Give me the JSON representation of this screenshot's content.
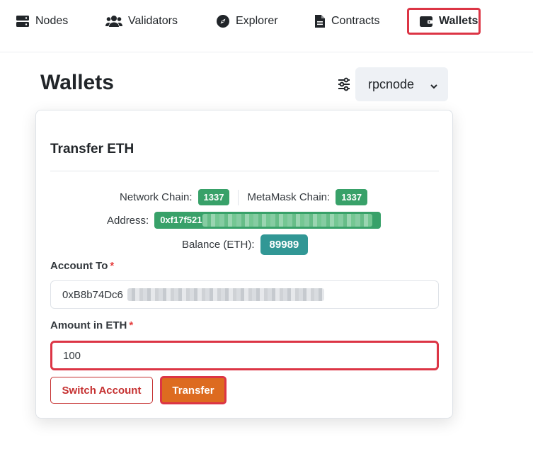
{
  "nav": {
    "nodes": "Nodes",
    "validators": "Validators",
    "explorer": "Explorer",
    "contracts": "Contracts",
    "wallets": "Wallets",
    "icons": [
      "server-icon",
      "users-icon",
      "compass-icon",
      "file-icon",
      "wallet-icon"
    ]
  },
  "page": {
    "title": "Wallets",
    "node_select": "rpcnode"
  },
  "card": {
    "title": "Transfer ETH",
    "network_chain_label": "Network Chain:",
    "network_chain_value": "1337",
    "metamask_chain_label": "MetaMask Chain:",
    "metamask_chain_value": "1337",
    "address_label": "Address:",
    "address_value": "0xf17f521",
    "balance_label": "Balance (ETH):",
    "balance_value": "89989",
    "account_to_label": "Account To",
    "account_to_value": "0xB8b74Dc6",
    "amount_label": "Amount in ETH",
    "amount_value": "100",
    "required_mark": "*",
    "switch_button": "Switch Account",
    "transfer_button": "Transfer"
  },
  "colors": {
    "badge_green": "#38a169",
    "badge_teal": "#319795",
    "danger": "#c53030",
    "highlight": "#dc3545",
    "transfer": "#dd6b20"
  }
}
